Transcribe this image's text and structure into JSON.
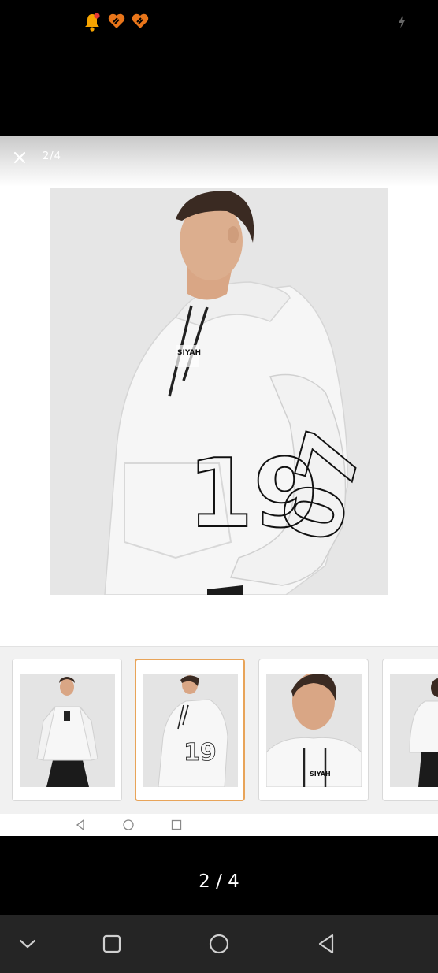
{
  "status_bar": {
    "icons": [
      "bell-notification-icon",
      "brand-heart-icon",
      "brand-heart-icon",
      "charging-icon"
    ]
  },
  "viewer": {
    "header_counter": "2/4",
    "close_icon": "close-icon",
    "main_image": {
      "description_icon": "product-photo",
      "chest_print": "SIYAH",
      "body_print": "19",
      "sleeve_print": "07"
    },
    "thumbnails": [
      {
        "index": 1,
        "view": "front",
        "selected": false
      },
      {
        "index": 2,
        "view": "three-quarter",
        "selected": true,
        "chest_print": "SIYAH",
        "print": "19",
        "sleeve": "07"
      },
      {
        "index": 3,
        "view": "close-up",
        "selected": false,
        "chest_print": "SIYAH"
      },
      {
        "index": 4,
        "view": "back",
        "selected": false
      }
    ],
    "inner_nav": [
      "back-icon",
      "home-icon",
      "recents-icon"
    ]
  },
  "caption": {
    "page_indicator": "2 / 4"
  },
  "system_nav": [
    "collapse-icon",
    "recents-icon",
    "home-icon",
    "back-icon"
  ],
  "colors": {
    "selected_border": "#e8a459",
    "notification": "#f7a400",
    "brand": "#e8751a"
  }
}
